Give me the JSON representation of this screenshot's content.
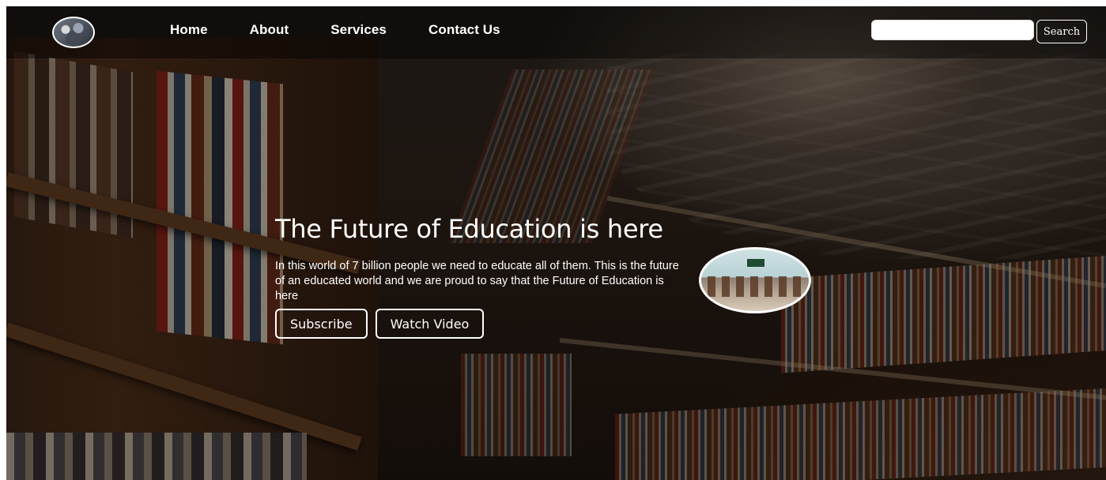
{
  "nav": {
    "links": [
      {
        "label": "Home"
      },
      {
        "label": "About"
      },
      {
        "label": "Services"
      },
      {
        "label": "Contact Us"
      }
    ],
    "search": {
      "value": "",
      "placeholder": "",
      "button_label": "Search"
    }
  },
  "hero": {
    "title": "The Future of Education is here",
    "text": "In this world of 7 billion people we need to educate all of them. This is the future of an educated world and we are proud to say that the Future of Education is here",
    "buttons": {
      "subscribe": "Subscribe",
      "watch_video": "Watch Video"
    }
  },
  "colors": {
    "text": "#ffffff",
    "navbar_overlay": "rgba(0,0,0,0.42)",
    "search_input_bg": "#ffffff"
  },
  "icons": {
    "logo": "logo-image",
    "hero_image": "classroom-image"
  }
}
